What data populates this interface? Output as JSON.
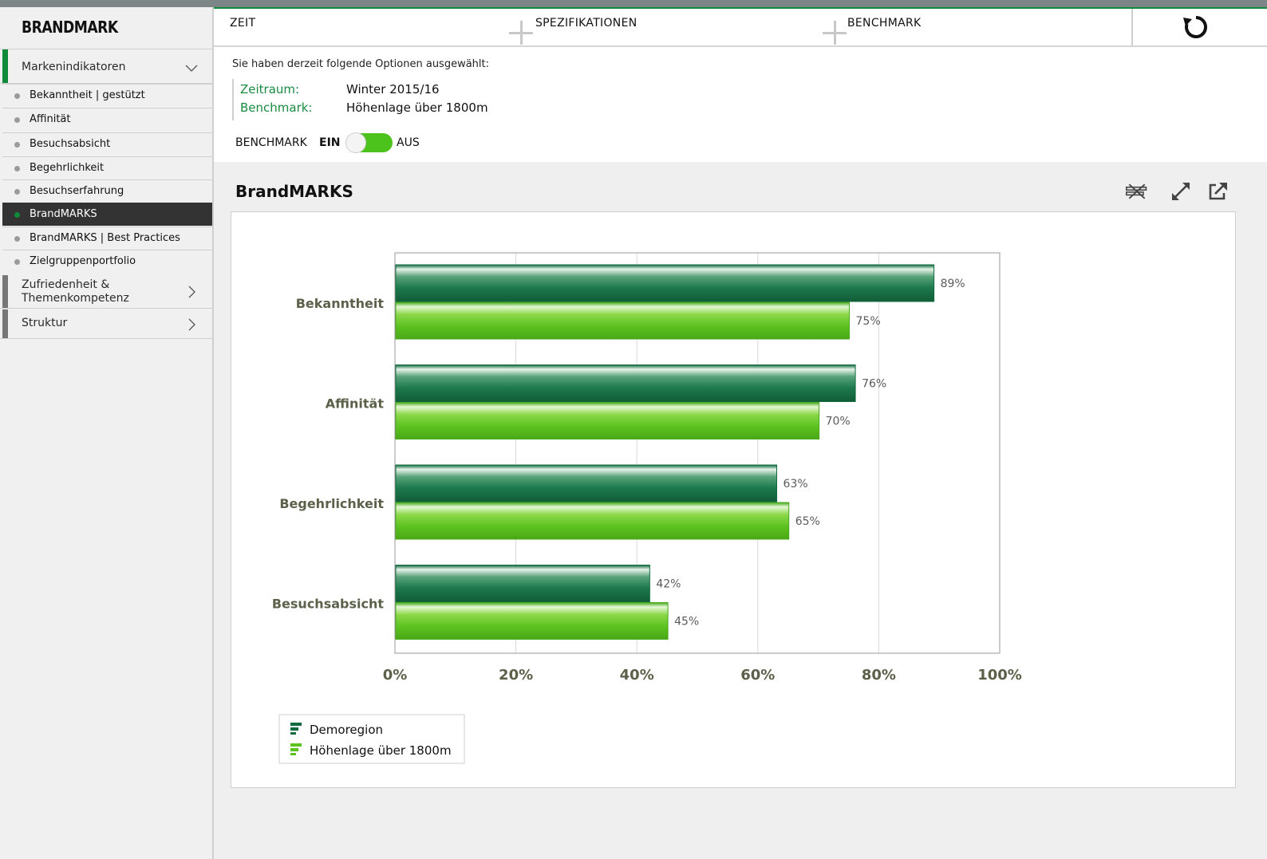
{
  "app": {
    "logo": "BRANDMARK"
  },
  "sidebar": {
    "section_marken": "Markenindikatoren",
    "items": [
      {
        "label": "Bekanntheit | gestützt",
        "active": false
      },
      {
        "label": "Affinität",
        "active": false
      },
      {
        "label": "Besuchsabsicht",
        "active": false
      },
      {
        "label": "Begehrlichkeit",
        "active": false
      },
      {
        "label": "Besuchserfahrung",
        "active": false
      },
      {
        "label": "BrandMARKS",
        "active": true
      },
      {
        "label": "BrandMARKS | Best Practices",
        "active": false
      },
      {
        "label": "Zielgruppenportfolio",
        "active": false
      }
    ],
    "section_zufr_line1": "Zufriedenheit &",
    "section_zufr_line2": "Themenkompetenz",
    "section_struktur": "Struktur"
  },
  "tabs": {
    "zeit": "ZEIT",
    "spez": "SPEZIFIKATIONEN",
    "bench": "BENCHMARK"
  },
  "selection": {
    "heading": "Sie haben derzeit folgende Optionen ausgewählt:",
    "zeitraum_label": "Zeitraum:",
    "zeitraum_value": "Winter 2015/16",
    "benchmark_label": "Benchmark:",
    "benchmark_value": "Höhenlage über 1800m"
  },
  "benchmark_toggle": {
    "label": "BENCHMARK",
    "on_label": "EIN",
    "off_label": "AUS"
  },
  "chart_header": {
    "title": "BrandMARKS"
  },
  "colors": {
    "accent": "#0e8a3b",
    "series_dark": "#1a7a4c",
    "series_light": "#5cc21f",
    "active_nav": "#333333"
  },
  "chart_data": {
    "type": "bar",
    "orientation": "horizontal",
    "categories": [
      "Bekanntheit",
      "Affinität",
      "Begehrlichkeit",
      "Besuchsabsicht"
    ],
    "series": [
      {
        "name": "Demoregion",
        "values": [
          89,
          76,
          63,
          42
        ],
        "labels": [
          "89%",
          "76%",
          "63%",
          "42%"
        ]
      },
      {
        "name": "Höhenlage über 1800m",
        "values": [
          75,
          70,
          65,
          45
        ],
        "labels": [
          "75%",
          "70%",
          "65%",
          "45%"
        ]
      }
    ],
    "xlim": [
      0,
      100
    ],
    "xticks": [
      "0%",
      "20%",
      "40%",
      "60%",
      "80%",
      "100%"
    ],
    "grid": true,
    "legend_position": "bottom-left"
  }
}
